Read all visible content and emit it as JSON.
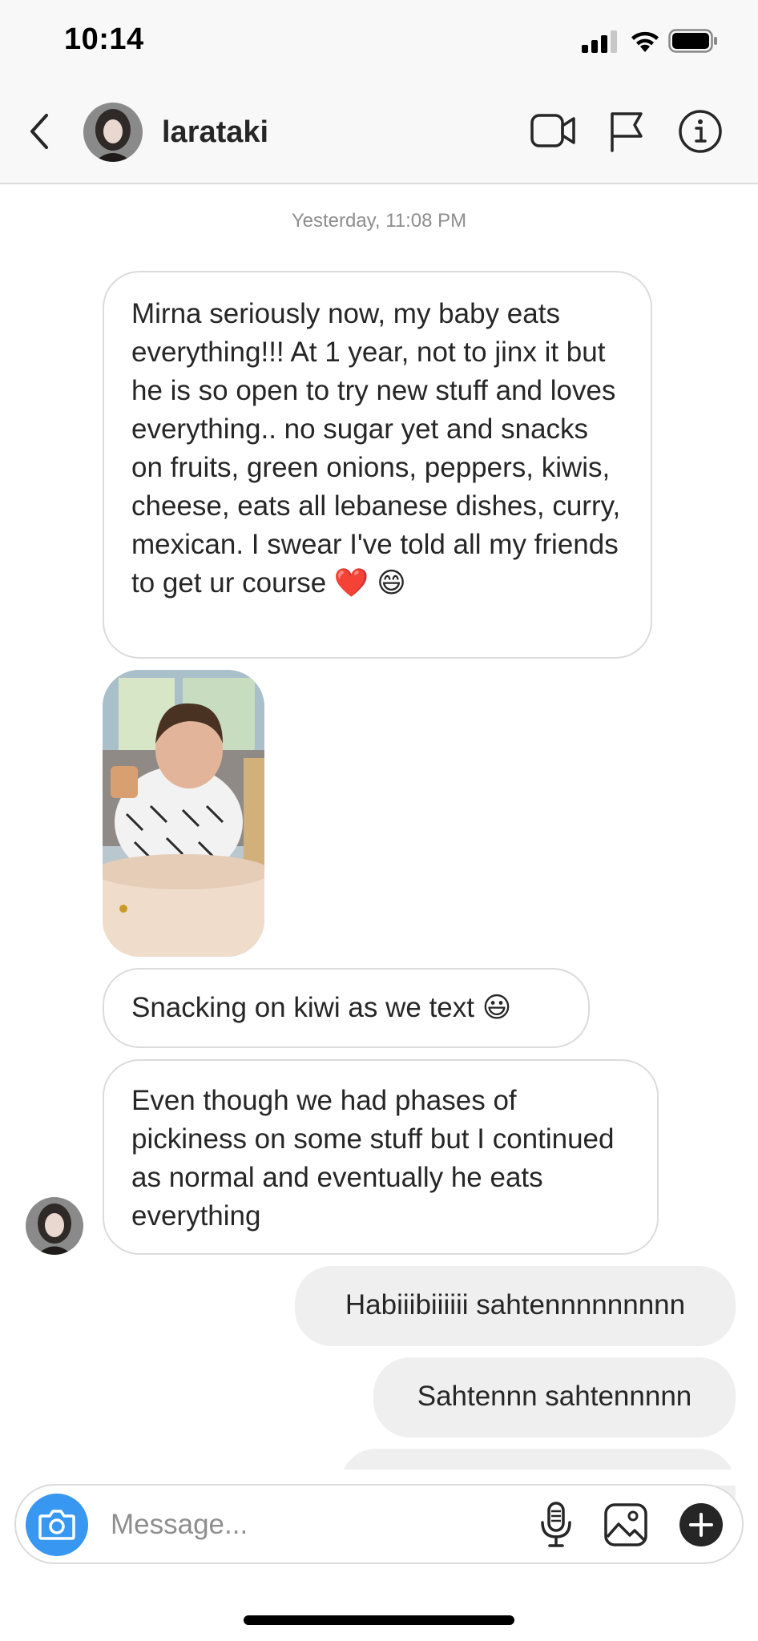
{
  "status_bar": {
    "time": "10:14",
    "signal_icon": "cellular-signal-icon",
    "wifi_icon": "wifi-icon",
    "battery_icon": "battery-icon"
  },
  "header": {
    "username": "larataki",
    "back_icon": "chevron-left-icon",
    "actions": [
      "video-call-icon",
      "flag-icon",
      "info-icon"
    ]
  },
  "conversation": {
    "timestamp": "Yesterday, 11:08 PM",
    "messages": [
      {
        "direction": "received",
        "text": "Mirna seriously now, my baby eats everything!!! At 1 year, not to jinx it but he is so open to try new stuff and loves everything.. no sugar yet and snacks on fruits, green onions, peppers, kiwis, cheese, eats all lebanese dishes, curry, mexican. I swear I've told all my friends to get ur course ❤️ 😄"
      },
      {
        "direction": "received",
        "type": "photo"
      },
      {
        "direction": "received",
        "text": "Snacking on kiwi as we text 😃"
      },
      {
        "direction": "received",
        "text": "Even though we had phases of pickiness on some stuff but I continued as normal and eventually he eats everything"
      },
      {
        "direction": "sent",
        "text": "Habiiibiiiiii sahtennnnnnnnn"
      },
      {
        "direction": "sent",
        "text": "Sahtennn sahtennnnn"
      }
    ]
  },
  "composer": {
    "placeholder": "Message...",
    "camera_icon": "camera-icon",
    "mic_icon": "microphone-icon",
    "gallery_icon": "gallery-icon",
    "plus_icon": "plus-circle-icon"
  },
  "colors": {
    "accent": "#3897f0",
    "bubble_sent": "#efefef",
    "bubble_border": "#dbdbdb",
    "header_bg": "#f8f8f8",
    "secondary_text": "#8e8e8e"
  }
}
